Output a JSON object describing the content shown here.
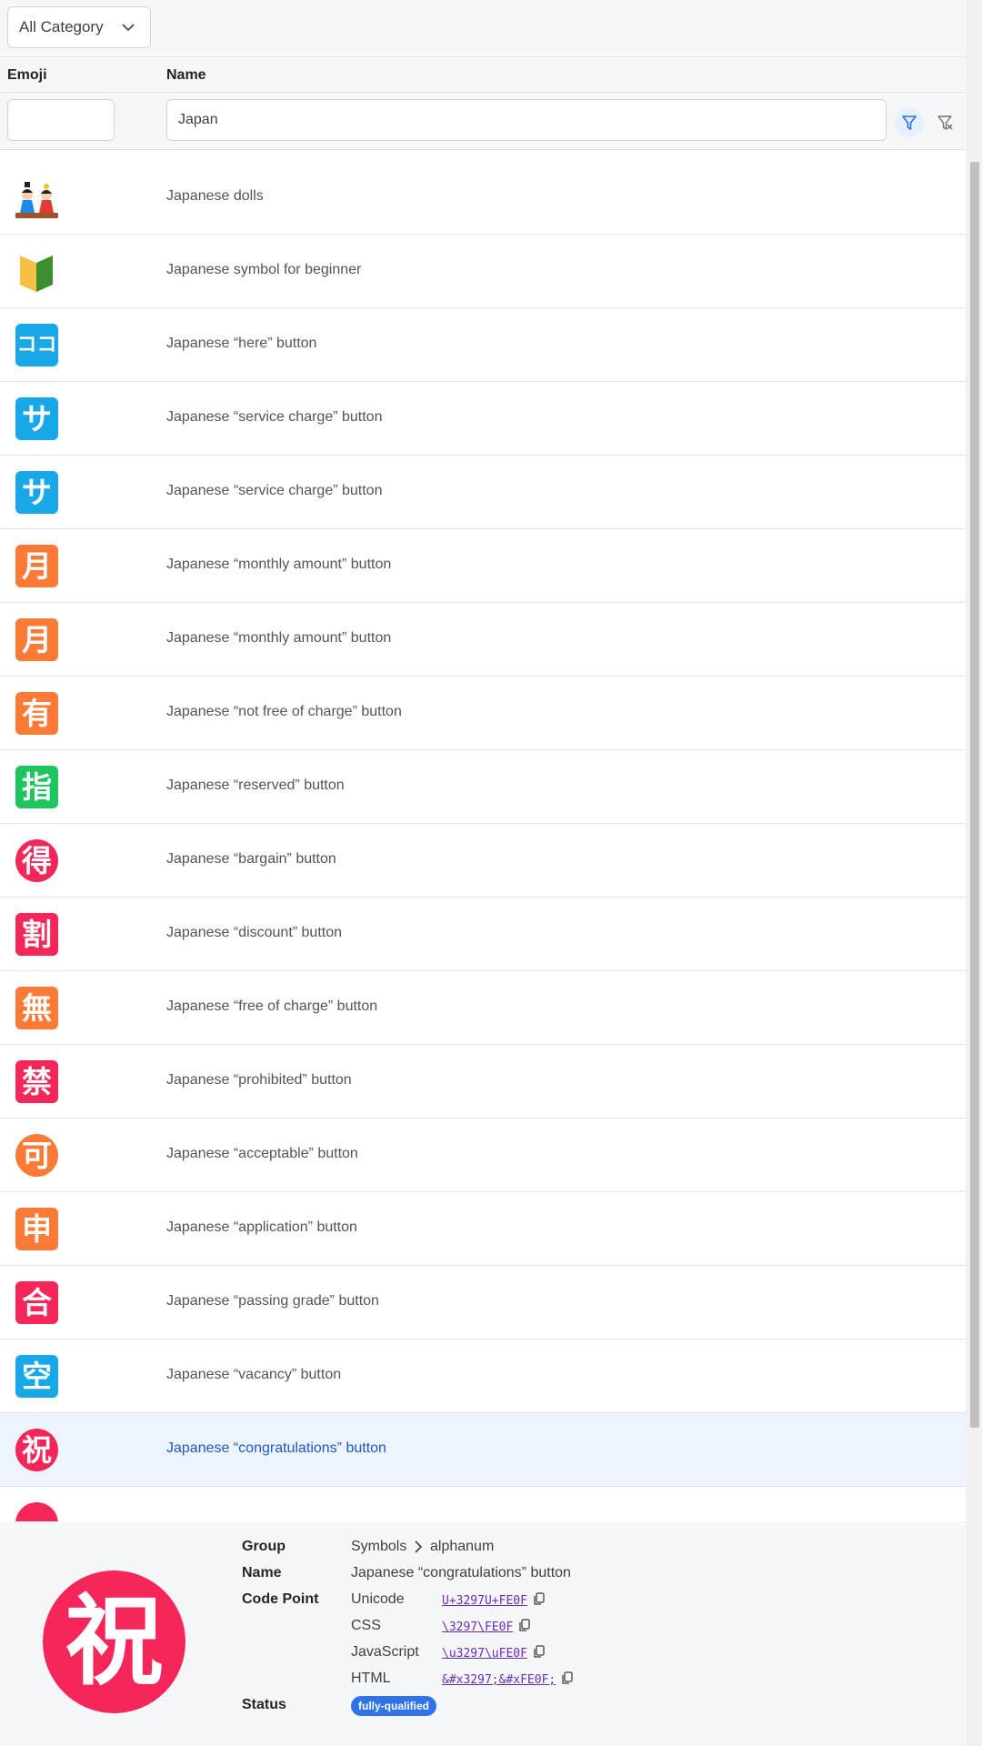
{
  "toolbar": {
    "category_select": "All Category"
  },
  "columns": {
    "emoji": "Emoji",
    "name": "Name"
  },
  "filters": {
    "emoji_value": "",
    "name_value": "Japan"
  },
  "rows": [
    {
      "name": "Japanese dolls",
      "icon": "japanese-dolls"
    },
    {
      "name": "Japanese symbol for beginner",
      "icon": "beginner-symbol"
    },
    {
      "name": "Japanese “here” button",
      "glyph": "ココ",
      "color": "#18a8e8"
    },
    {
      "name": "Japanese “service charge” button",
      "glyph": "サ",
      "color": "#18a8e8"
    },
    {
      "name": "Japanese “service charge” button",
      "glyph": "サ",
      "color": "#18a8e8"
    },
    {
      "name": "Japanese “monthly amount” button",
      "glyph": "月",
      "color": "#fb7a35"
    },
    {
      "name": "Japanese “monthly amount” button",
      "glyph": "月",
      "color": "#fb7a35"
    },
    {
      "name": "Japanese “not free of charge” button",
      "glyph": "有",
      "color": "#fb7a35"
    },
    {
      "name": "Japanese “reserved” button",
      "glyph": "指",
      "color": "#1ec55f"
    },
    {
      "name": "Japanese “bargain” button",
      "glyph": "得",
      "color": "#f5265a",
      "shape": "circle"
    },
    {
      "name": "Japanese “discount” button",
      "glyph": "割",
      "color": "#f5265a"
    },
    {
      "name": "Japanese “free of charge” button",
      "glyph": "無",
      "color": "#fb7a35"
    },
    {
      "name": "Japanese “prohibited” button",
      "glyph": "禁",
      "color": "#f5265a"
    },
    {
      "name": "Japanese “acceptable” button",
      "glyph": "可",
      "color": "#fb7a35",
      "shape": "circle"
    },
    {
      "name": "Japanese “application” button",
      "glyph": "申",
      "color": "#fb7a35"
    },
    {
      "name": "Japanese “passing grade” button",
      "glyph": "合",
      "color": "#f5265a"
    },
    {
      "name": "Japanese “vacancy” button",
      "glyph": "空",
      "color": "#18a8e8"
    },
    {
      "name": "Japanese “congratulations” button",
      "glyph": "祝",
      "color": "#f5265a",
      "shape": "circle",
      "selected": true
    }
  ],
  "detail": {
    "emoji": "祝",
    "group_label": "Group",
    "group": "Symbols",
    "subgroup": "alphanum",
    "name_label": "Name",
    "name": "Japanese “congratulations” button",
    "codepoint_label": "Code Point",
    "unicode_label": "Unicode",
    "unicode": "U+3297U+FE0F",
    "css_label": "CSS",
    "css": "\\3297\\FE0F",
    "js_label": "JavaScript",
    "js": "\\u3297\\uFE0F",
    "html_label": "HTML",
    "html": "&#x3297;&#xFE0F;",
    "status_label": "Status",
    "status": "fully-qualified"
  }
}
